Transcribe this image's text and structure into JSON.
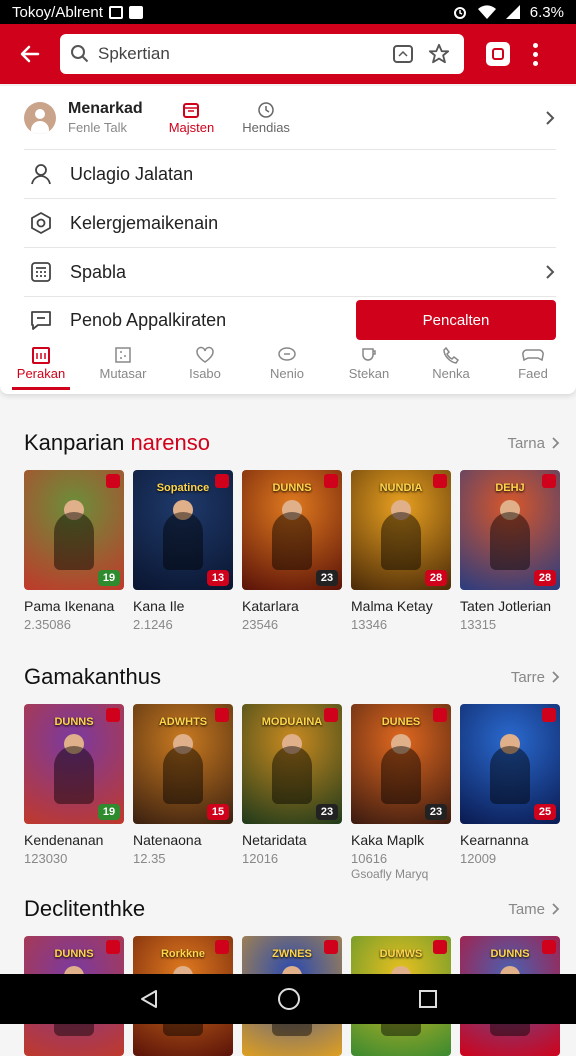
{
  "status_bar": {
    "left_text": "Tokoy/Ablrent",
    "right_text": "6.3%"
  },
  "search": {
    "query": "Spkertian"
  },
  "profile": {
    "name": "Menarkad",
    "subtitle": "Fenle Talk",
    "tabs": [
      {
        "label": "Majsten",
        "active": true
      },
      {
        "label": "Hendias",
        "active": false
      }
    ]
  },
  "menu": {
    "items": [
      {
        "label": "Uclagio Jalatan"
      },
      {
        "label": "Kelergjemaikenain"
      },
      {
        "label": "Spabla"
      },
      {
        "label": "Penob Appalkiraten"
      }
    ],
    "cta_label": "Pencalten"
  },
  "tabs": [
    {
      "label": "Perakan",
      "active": true
    },
    {
      "label": "Mutasar",
      "active": false
    },
    {
      "label": "Isabo",
      "active": false
    },
    {
      "label": "Nenio",
      "active": false
    },
    {
      "label": "Stekan",
      "active": false
    },
    {
      "label": "Nenka",
      "active": false
    },
    {
      "label": "Faed",
      "active": false
    }
  ],
  "sections": [
    {
      "title_main": "Kanparian",
      "title_accent": "narenso",
      "more_label": "Tarna",
      "cards": [
        {
          "title": "Pama Ikenana",
          "count": "2.35086",
          "extra": "",
          "badge": "19",
          "banner": "",
          "colors": [
            "#6b8f3a",
            "#c0392b"
          ]
        },
        {
          "title": "Kana Ile",
          "count": "2.1246",
          "extra": "",
          "badge": "13",
          "banner": "Sopatince",
          "colors": [
            "#1f3a6b",
            "#0a1530"
          ]
        },
        {
          "title": "Katarlara",
          "count": "23546",
          "extra": "",
          "badge": "23",
          "banner": "DUNNS",
          "colors": [
            "#e07a1f",
            "#5a1208"
          ]
        },
        {
          "title": "Malma Ketay",
          "count": "13346",
          "extra": "",
          "badge": "28",
          "banner": "NUNDIA",
          "colors": [
            "#e8a020",
            "#4a2a08"
          ]
        },
        {
          "title": "Taten Jotlerian",
          "count": "13315",
          "extra": "",
          "badge": "28",
          "banner": "DEHJ",
          "colors": [
            "#d8572a",
            "#2a3c80"
          ]
        }
      ]
    },
    {
      "title_main": "Gamakanthus",
      "title_accent": "",
      "more_label": "Tarre",
      "cards": [
        {
          "title": "Kendenanan",
          "count": "123030",
          "extra": "",
          "badge": "19",
          "banner": "DUNNS",
          "colors": [
            "#7a3aa0",
            "#c0392b"
          ]
        },
        {
          "title": "Natenaona",
          "count": "12.35",
          "extra": "",
          "badge": "15",
          "banner": "ADWHTS",
          "colors": [
            "#c97a20",
            "#3a2010"
          ]
        },
        {
          "title": "Netaridata",
          "count": "12016",
          "extra": "",
          "badge": "23",
          "banner": "MODUAINA",
          "colors": [
            "#c98a20",
            "#1f3a1a"
          ]
        },
        {
          "title": "Kaka Maplk",
          "count": "10616",
          "extra": "Gsoafly Maryq",
          "badge": "23",
          "banner": "DUNES",
          "colors": [
            "#e0681f",
            "#3a1a10"
          ]
        },
        {
          "title": "Kearnanna",
          "count": "12009",
          "extra": "",
          "badge": "25",
          "banner": "",
          "colors": [
            "#2a6ad0",
            "#0a1a50"
          ]
        }
      ]
    },
    {
      "title_main": "Declitenthke",
      "title_accent": "",
      "more_label": "Tame",
      "cards": [
        {
          "title": "",
          "count": "",
          "extra": "",
          "badge": "",
          "banner": "DUNNS",
          "colors": [
            "#7a3aa0",
            "#c0392b"
          ]
        },
        {
          "title": "",
          "count": "",
          "extra": "",
          "badge": "",
          "banner": "Rorkkne",
          "colors": [
            "#e07a1f",
            "#5a1208"
          ]
        },
        {
          "title": "",
          "count": "",
          "extra": "",
          "badge": "",
          "banner": "ZWNES",
          "colors": [
            "#2a4ab0",
            "#e0a020"
          ]
        },
        {
          "title": "",
          "count": "",
          "extra": "",
          "badge": "",
          "banner": "DUMWS",
          "colors": [
            "#e8c020",
            "#3a8a30"
          ]
        },
        {
          "title": "",
          "count": "",
          "extra": "",
          "badge": "",
          "banner": "DUNNS",
          "colors": [
            "#4a60b0",
            "#d0021b"
          ]
        }
      ]
    }
  ]
}
